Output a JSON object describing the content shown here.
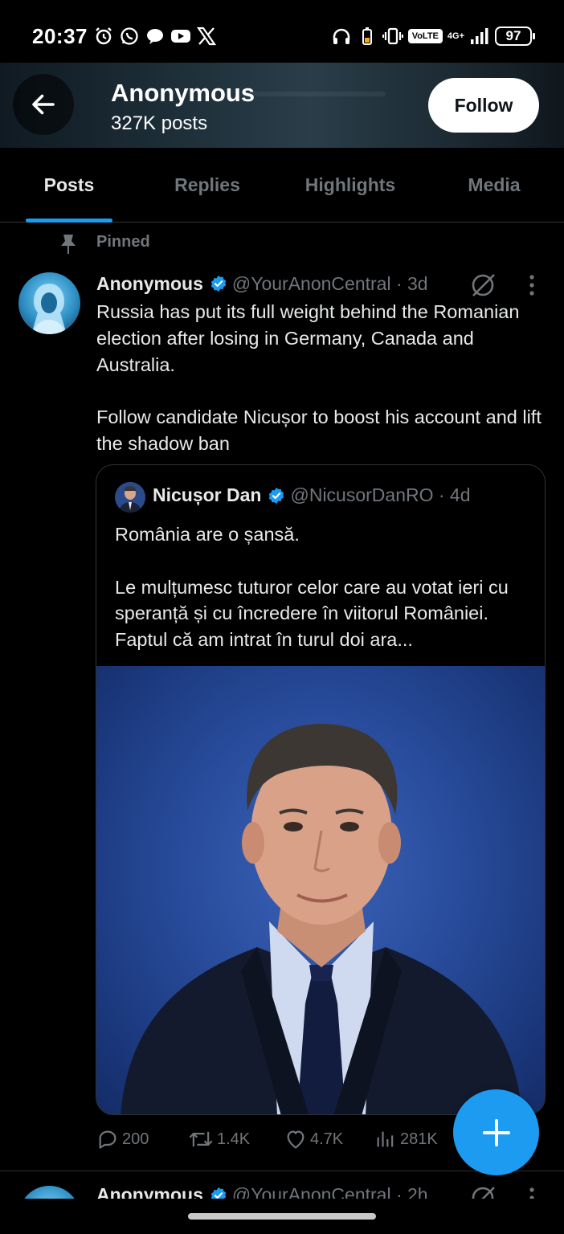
{
  "status_bar": {
    "time": "20:37",
    "volte": "VoLTE",
    "network": "4G+",
    "battery": "97"
  },
  "header": {
    "title": "Anonymous",
    "posts_count": "327K posts",
    "follow_label": "Follow"
  },
  "tabs": [
    {
      "label": "Posts",
      "active": true
    },
    {
      "label": "Replies",
      "active": false
    },
    {
      "label": "Highlights",
      "active": false
    },
    {
      "label": "Media",
      "active": false
    }
  ],
  "pinned_label": "Pinned",
  "tweet": {
    "name": "Anonymous",
    "handle": "@YourAnonCentral · 3d",
    "text": "Russia has put its full weight behind the Romanian election after losing in Germany, Canada and Australia.\n\nFollow candidate Nicușor to boost his account and lift the shadow ban",
    "quote": {
      "name": "Nicușor Dan",
      "handle": "@NicusorDanRO · 4d",
      "text": "România are o șansă.\n\nLe mulțumesc tuturor celor care au votat ieri cu speranță și cu încredere în viitorul României. Faptul că am intrat în turul doi ara..."
    },
    "actions": {
      "replies": "200",
      "reposts": "1.4K",
      "likes": "4.7K",
      "views": "281K"
    }
  },
  "next_tweet": {
    "name": "Anonymous",
    "handle": "@YourAnonCentral · 2h"
  },
  "colors": {
    "accent": "#1d9bf0",
    "background": "#000000",
    "muted": "#71767b",
    "text": "#e7e9ea"
  }
}
